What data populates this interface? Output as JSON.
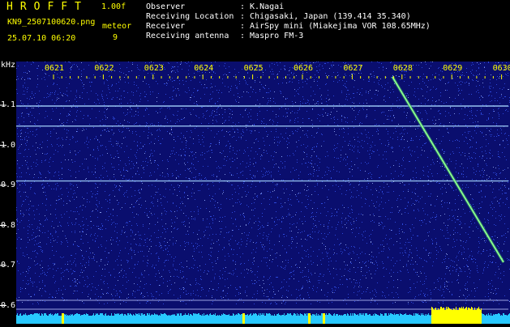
{
  "header": {
    "app_title": "HROFFT",
    "version": "1.00f",
    "filename": "KN9_2507100620.png",
    "datetime": "25.07.10 06:20",
    "meteor_label": "meteor",
    "meteor_count": "9"
  },
  "info": [
    {
      "key": "Observer",
      "value": ": K.Nagai"
    },
    {
      "key": "Receiving Location",
      "value": ": Chigasaki, Japan (139.414 35.340)"
    },
    {
      "key": "Receiver",
      "value": ": AirSpy mini (Miakejima VOR 108.65MHz)"
    },
    {
      "key": "Receiving antenna",
      "value": ": Maspro FM-3"
    }
  ],
  "axis": {
    "unit": "kHz",
    "y_ticks": [
      "1.1",
      "1.0",
      "0.9",
      "0.8",
      "0.7",
      "0.6"
    ],
    "time_ticks": [
      "0621",
      "0622",
      "0623",
      "0624",
      "0625",
      "0626",
      "0627",
      "0628",
      "0629",
      "0630"
    ]
  },
  "colors": {
    "background": "#000000",
    "spectrogram_base": "#0a0e6e",
    "noise_dot": "#3a5cff",
    "carrier_line": "#a8d8ff",
    "meteor_trail": "#8cff8c",
    "level_bar": "#28c8ff",
    "level_peak": "#ffff00"
  }
}
